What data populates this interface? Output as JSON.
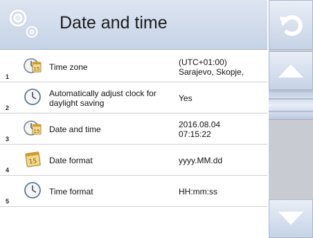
{
  "header": {
    "title": "Date and time",
    "icon": "gears-icon"
  },
  "sidebar": {
    "undo_icon": "undo-icon",
    "up_icon": "arrow-up-icon",
    "down_icon": "arrow-down-icon"
  },
  "rows": [
    {
      "num": "1",
      "icon": "clock-calendar-icon",
      "label": "Time zone",
      "value": "(UTC+01:00)\nSarajevo, Skopje,"
    },
    {
      "num": "2",
      "icon": "clock-icon",
      "label": "Automatically adjust clock for daylight saving",
      "value": "Yes"
    },
    {
      "num": "3",
      "icon": "clock-calendar-icon",
      "label": "Date and time",
      "value": "2016.08.04\n07:15:22"
    },
    {
      "num": "4",
      "icon": "calendar-icon",
      "label": "Date format",
      "value": "yyyy.MM.dd"
    },
    {
      "num": "5",
      "icon": "clock-icon",
      "label": "Time format",
      "value": "HH:mm:ss"
    }
  ]
}
